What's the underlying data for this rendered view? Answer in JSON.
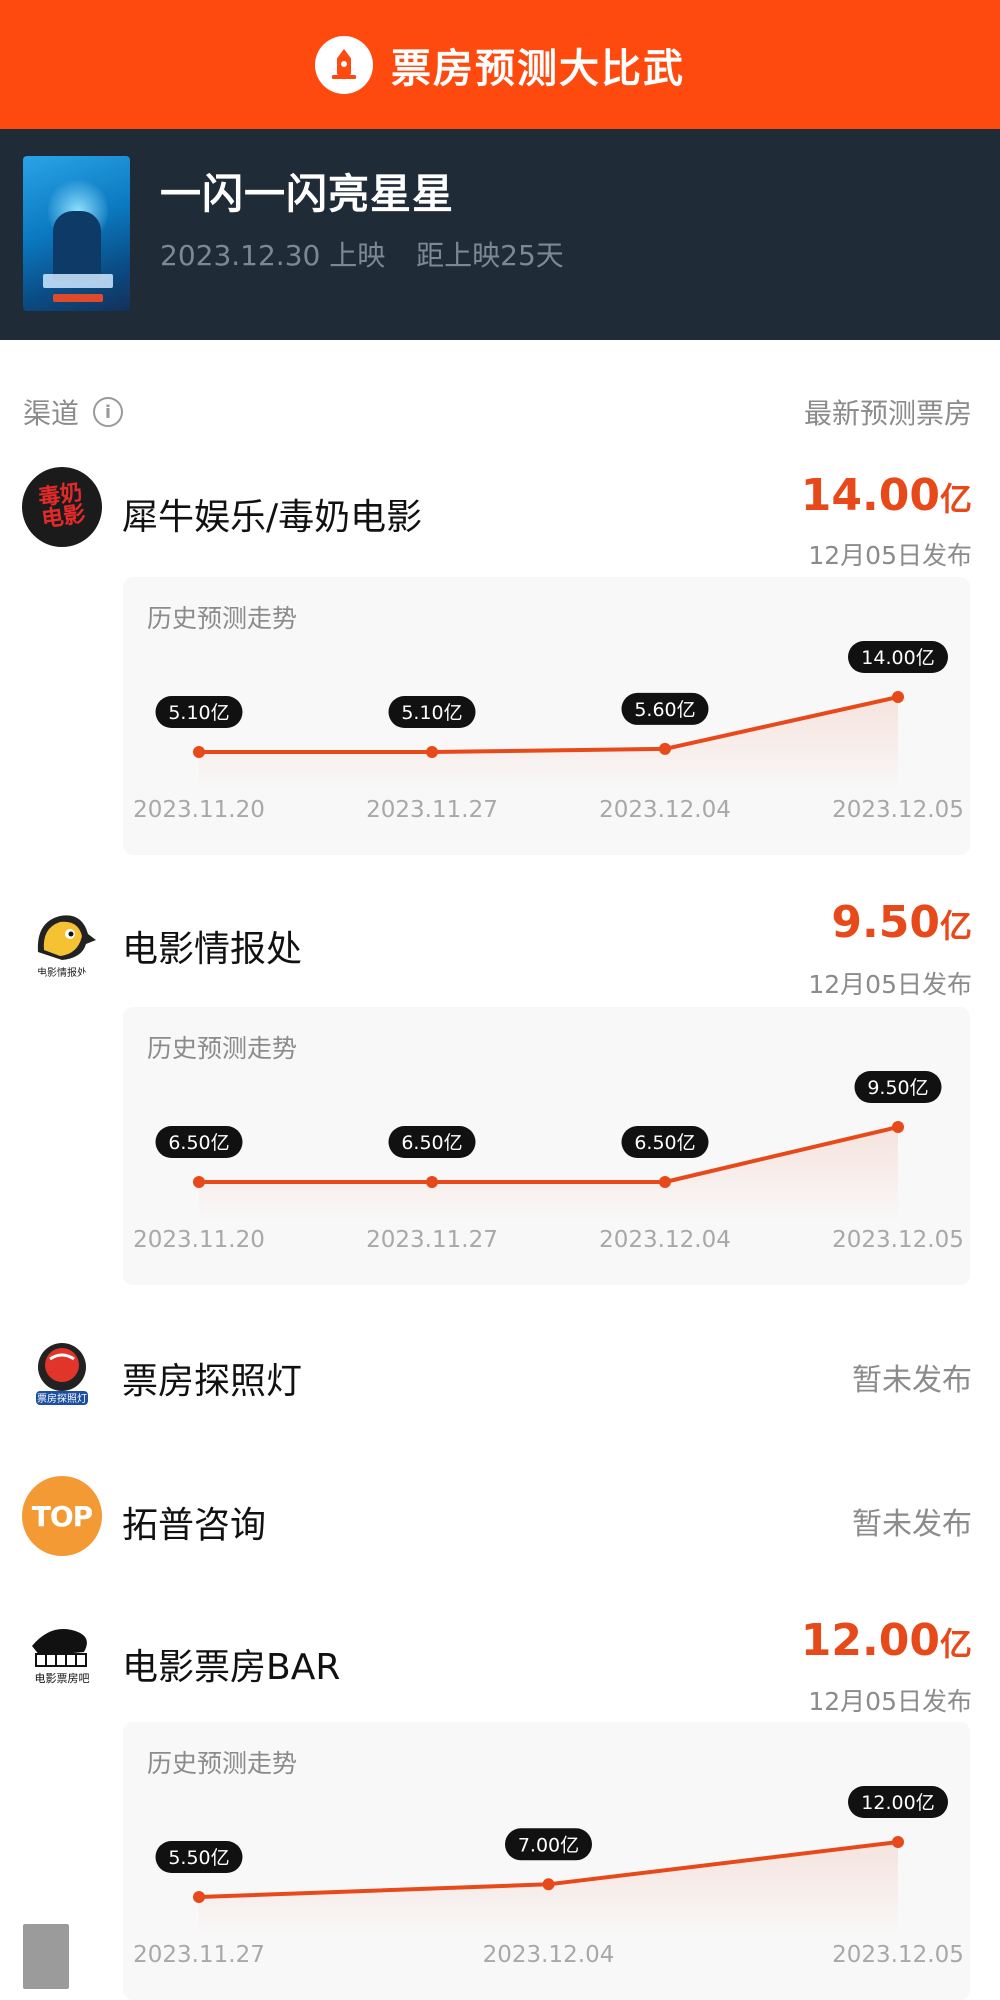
{
  "topbar": {
    "title": "票房预测大比武",
    "icon": "lighthouse-icon",
    "color": "#ff4a0f"
  },
  "movie": {
    "title": "一闪一闪亮星星",
    "release": "2023.12.30 上映",
    "countdown": "距上映25天"
  },
  "table_header": {
    "left": "渠道",
    "right": "最新预测票房"
  },
  "channels": [
    {
      "name": "犀牛娱乐/毒奶电影",
      "logo_text": "毒奶电影",
      "value": "14.00",
      "unit": "亿",
      "date": "12月05日发布",
      "trend": {
        "title": "历史预测走势",
        "points": [
          {
            "date": "2023.11.20",
            "label": "5.10亿",
            "value": 5.1
          },
          {
            "date": "2023.11.27",
            "label": "5.10亿",
            "value": 5.1
          },
          {
            "date": "2023.12.04",
            "label": "5.60亿",
            "value": 5.6
          },
          {
            "date": "2023.12.05",
            "label": "14.00亿",
            "value": 14.0
          }
        ]
      }
    },
    {
      "name": "电影情报处",
      "logo_text": "电影情报处",
      "value": "9.50",
      "unit": "亿",
      "date": "12月05日发布",
      "trend": {
        "title": "历史预测走势",
        "points": [
          {
            "date": "2023.11.20",
            "label": "6.50亿",
            "value": 6.5
          },
          {
            "date": "2023.11.27",
            "label": "6.50亿",
            "value": 6.5
          },
          {
            "date": "2023.12.04",
            "label": "6.50亿",
            "value": 6.5
          },
          {
            "date": "2023.12.05",
            "label": "9.50亿",
            "value": 9.5
          }
        ]
      }
    },
    {
      "name": "票房探照灯",
      "logo_text": "票房探照灯",
      "status": "暂未发布"
    },
    {
      "name": "拓普咨询",
      "logo_text": "TOP",
      "status": "暂未发布"
    },
    {
      "name": "电影票房BAR",
      "logo_text": "电影票房吧",
      "value": "12.00",
      "unit": "亿",
      "date": "12月05日发布",
      "trend": {
        "title": "历史预测走势",
        "points": [
          {
            "date": "2023.11.27",
            "label": "5.50亿",
            "value": 5.5
          },
          {
            "date": "2023.12.04",
            "label": "7.00亿",
            "value": 7.0
          },
          {
            "date": "2023.12.05",
            "label": "12.00亿",
            "value": 12.0
          }
        ]
      }
    }
  ],
  "chart_data": [
    {
      "type": "line",
      "title": "历史预测走势",
      "x": [
        "2023.11.20",
        "2023.11.27",
        "2023.12.04",
        "2023.12.05"
      ],
      "series": [
        {
          "values": [
            5.1,
            5.1,
            5.6,
            14.0
          ]
        }
      ]
    },
    {
      "type": "line",
      "title": "历史预测走势",
      "x": [
        "2023.11.20",
        "2023.11.27",
        "2023.12.04",
        "2023.12.05"
      ],
      "series": [
        {
          "values": [
            6.5,
            6.5,
            6.5,
            9.5
          ]
        }
      ]
    },
    {
      "type": "line",
      "title": "历史预测走势",
      "x": [
        "2023.11.27",
        "2023.12.04",
        "2023.12.05"
      ],
      "series": [
        {
          "values": [
            5.5,
            7.0,
            12.0
          ]
        }
      ]
    }
  ],
  "colors": {
    "accent": "#e8491b",
    "dark_header": "#1f2b37",
    "label_bg": "#111111"
  }
}
